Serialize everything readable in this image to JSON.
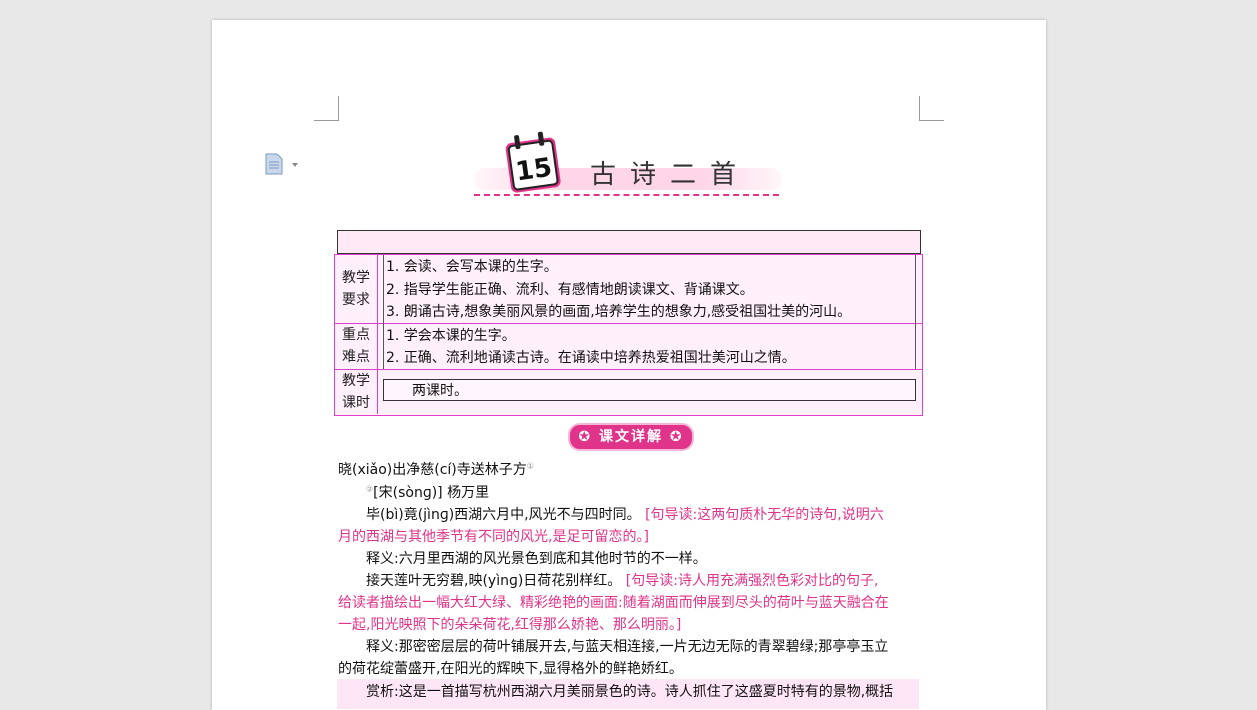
{
  "title": {
    "number": "15",
    "text": "古诗二首"
  },
  "table": {
    "rows": [
      {
        "label1": "教学",
        "label2": "要求",
        "lines": [
          "1. 会读、会写本课的生字。",
          "2. 指导学生能正确、流利、有感情地朗读课文、背诵课文。",
          "3. 朗诵古诗,想象美丽风景的画面,培养学生的想象力,感受祖国壮美的河山。"
        ]
      },
      {
        "label1": "重点",
        "label2": "难点",
        "lines": [
          "1.  学会本课的生字。",
          "2. 正确、流利地诵读古诗。在诵读中培养热爱祖国壮美河山之情。"
        ]
      },
      {
        "label1": "教学",
        "label2": "课时",
        "lines": [
          "两课时。"
        ]
      }
    ]
  },
  "section_title": "✪ 课文详解 ✪",
  "poem": {
    "title": "晓(xiǎo)出净慈(cí)寺送林子方",
    "author": "[宋(sònɡ)] 杨万里",
    "line1_text": "毕(bì)竟(jìnɡ)西湖六月中,风光不与四时同。",
    "line1_guide_a": "[句导读:这两句质朴无华的诗句,说明六",
    "line1_guide_b": "月的西湖与其他季节有不同的风光,是足可留恋的。]",
    "trans1": "释义:六月里西湖的风光景色到底和其他时节的不一样。",
    "line2_text": "接天莲叶无穷碧,映(yìnɡ)日荷花别样红。",
    "line2_guide_a": "[句导读:诗人用充满强烈色彩对比的句子,",
    "line2_guide_b": "给读者描绘出一幅大红大绿、精彩绝艳的画面:随着湖面而伸展到尽头的荷叶与蓝天融合在",
    "line2_guide_c": "一起,阳光映照下的朵朵荷花,红得那么娇艳、那么明丽。]",
    "trans2_a": "释义:那密密层层的荷叶铺展开去,与蓝天相连接,一片无边无际的青翠碧绿;那亭亭玉立",
    "trans2_b": "的荷花绽蕾盛开,在阳光的辉映下,显得格外的鲜艳娇红。",
    "analysis": "赏析:这是一首描写杭州西湖六月美丽景色的诗。诗人抓住了这盛夏时特有的景物,概括"
  },
  "colors": {
    "accent": "#e0338a",
    "table_border": "#e040c8",
    "table_fill": "#fff0fb"
  },
  "icons": {
    "doc": "document-icon",
    "calendar": "calendar-icon"
  }
}
